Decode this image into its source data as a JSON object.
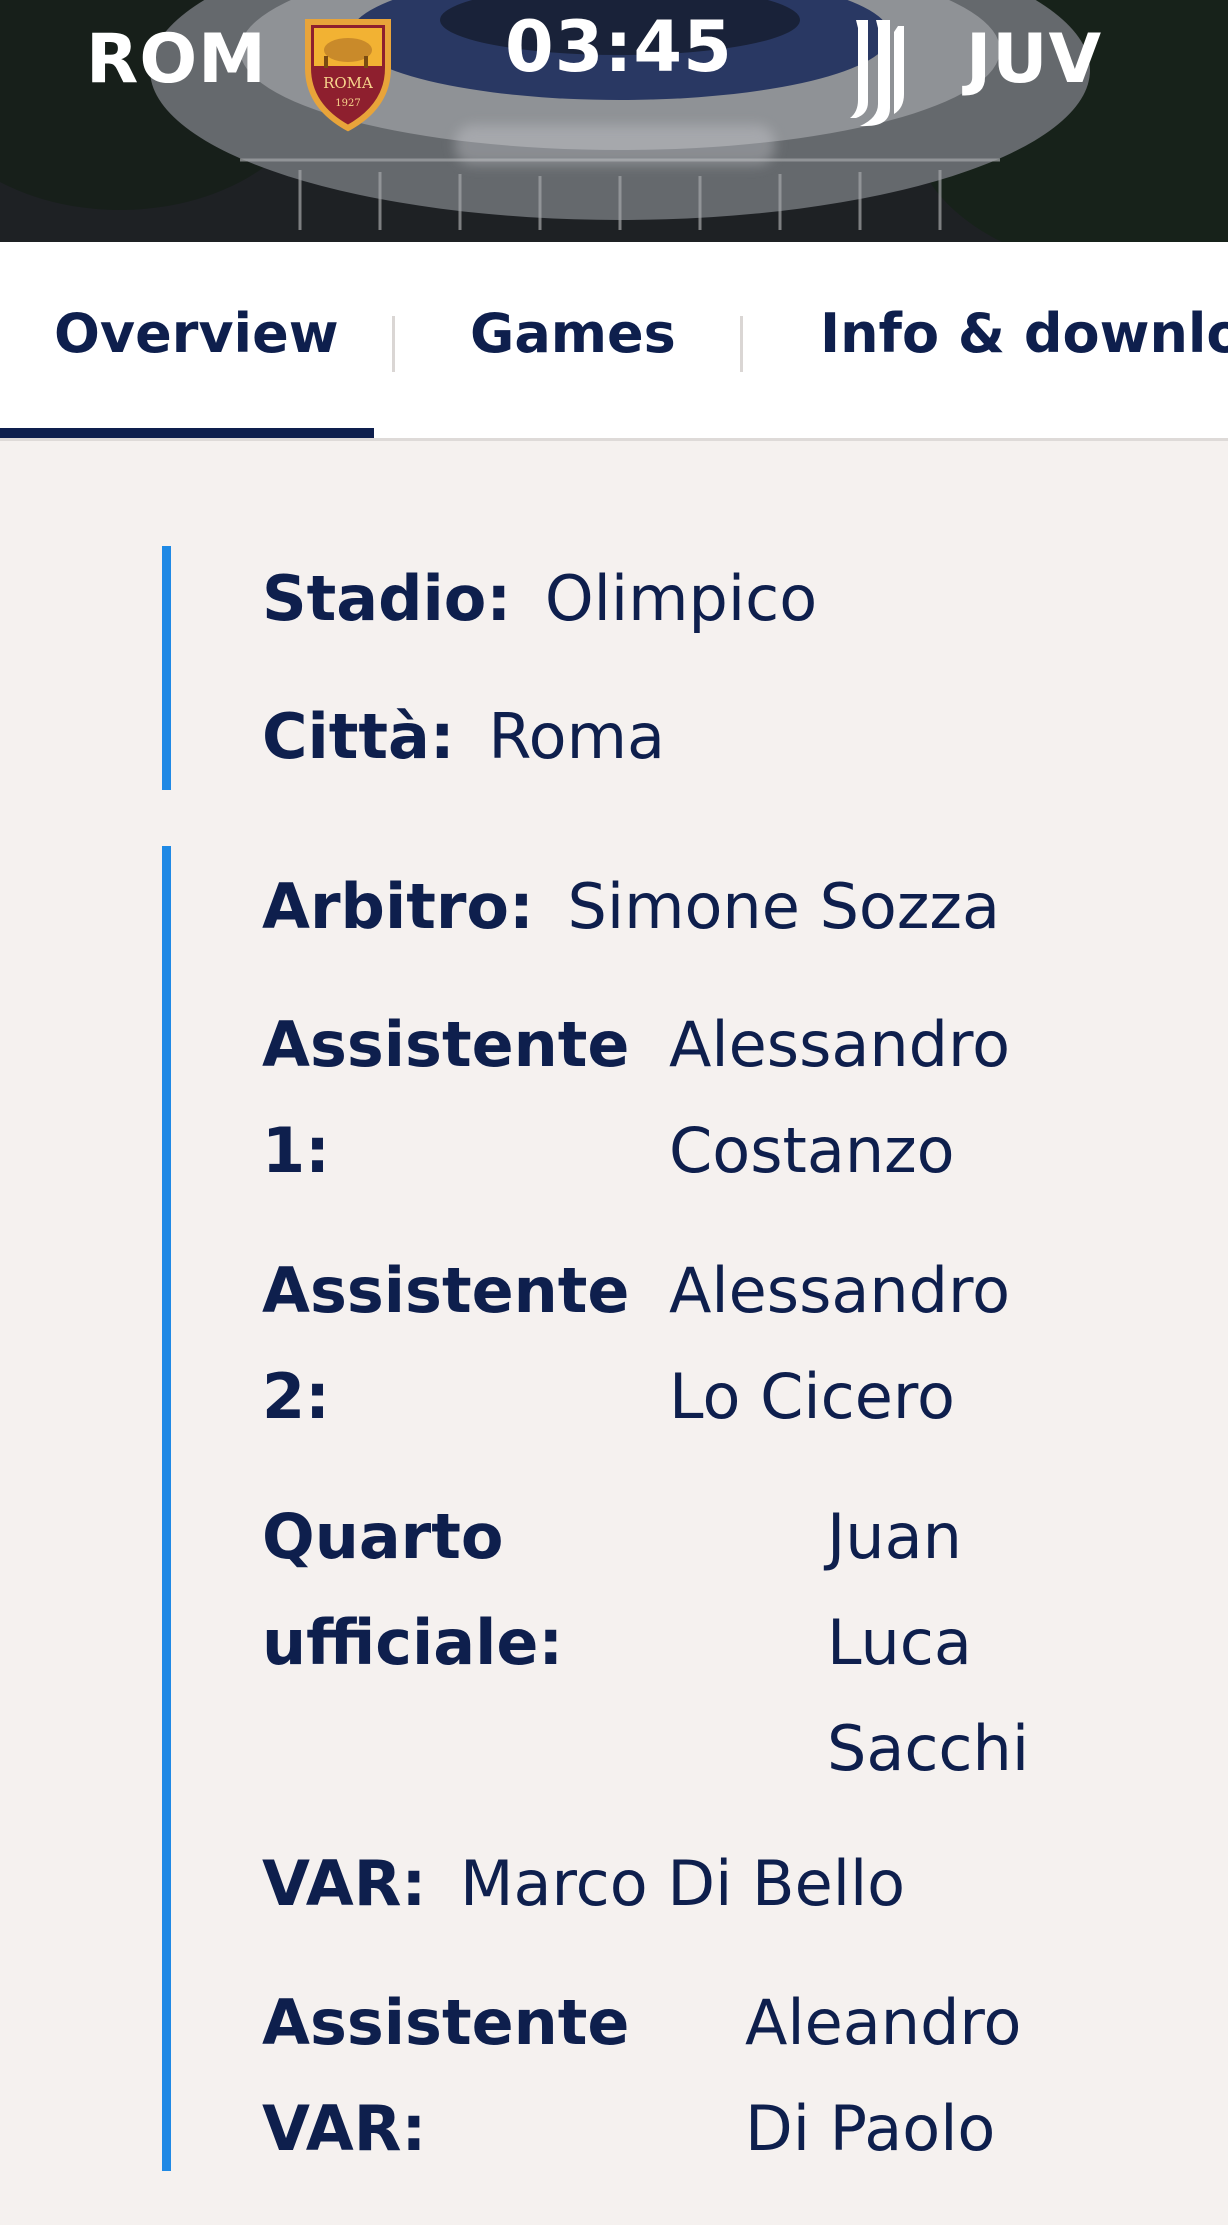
{
  "scoreboard": {
    "home_team": "ROM",
    "away_team": "JUV",
    "clock": "03:45",
    "home_crest_text": "ROMA",
    "home_crest_year": "1927",
    "home_crest_icon": "as-roma-crest-icon",
    "away_crest_icon": "juventus-logo-icon"
  },
  "tabs": {
    "overview": "Overview",
    "games": "Games",
    "info": "Info & downloa"
  },
  "venue": {
    "stadium_label": "Stadio:",
    "stadium_value": "Olimpico",
    "city_label": "Città:",
    "city_value": "Roma"
  },
  "officials": {
    "referee_label": "Arbitro:",
    "referee_value": "Simone Sozza",
    "assistant1_label_1": "Assistente",
    "assistant1_label_2": "1:",
    "assistant1_value_1": "Alessandro",
    "assistant1_value_2": "Costanzo",
    "assistant2_label_1": "Assistente",
    "assistant2_label_2": "2:",
    "assistant2_value_1": "Alessandro",
    "assistant2_value_2": "Lo Cicero",
    "fourth_label_1": "Quarto",
    "fourth_label_2": "ufficiale:",
    "fourth_value_1": "Juan",
    "fourth_value_2": "Luca",
    "fourth_value_3": "Sacchi",
    "var_label": "VAR:",
    "var_value": "Marco Di Bello",
    "avar_label_1": "Assistente",
    "avar_label_2": "VAR:",
    "avar_value_1": "Aleandro",
    "avar_value_2": "Di Paolo"
  },
  "colors": {
    "navy": "#0e1f4d",
    "accent_blue": "#1f89e5",
    "background": "#f5f1ef"
  }
}
